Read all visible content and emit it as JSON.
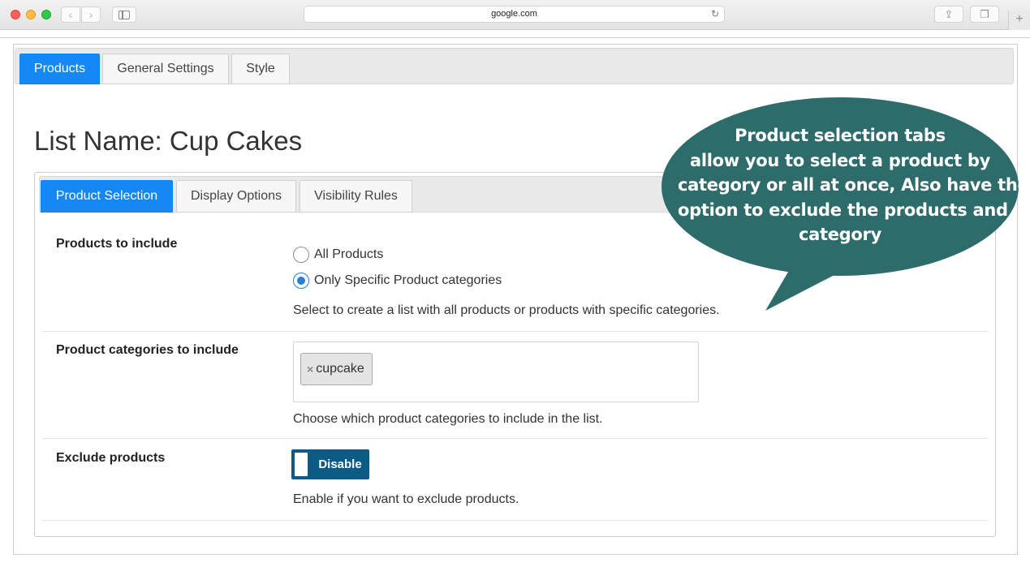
{
  "browser": {
    "url": "google.com"
  },
  "main_tabs": [
    {
      "label": "Products",
      "active": true
    },
    {
      "label": "General Settings",
      "active": false
    },
    {
      "label": "Style",
      "active": false
    }
  ],
  "page": {
    "title": "List Name: Cup Cakes"
  },
  "inner_tabs": [
    {
      "label": "Product Selection",
      "active": true
    },
    {
      "label": "Display Options",
      "active": false
    },
    {
      "label": "Visibility Rules",
      "active": false
    }
  ],
  "products_to_include": {
    "label": "Products to include",
    "options": [
      {
        "label": "All Products",
        "checked": false
      },
      {
        "label": "Only Specific Product categories",
        "checked": true
      }
    ],
    "help": "Select to create a list with all products or products with specific categories."
  },
  "categories_to_include": {
    "label": "Product categories to include",
    "selected": [
      "cupcake"
    ],
    "remove_glyph": "×",
    "help": "Choose which product categories to include in the list."
  },
  "exclude_products": {
    "label": "Exclude products",
    "toggle_label": "Disable",
    "enabled": false,
    "help": "Enable if you want to exclude products."
  },
  "callout": {
    "lines": [
      "Product selection tabs",
      "allow you to select a product by",
      "category or all at once, Also have the",
      "option to exclude the products and",
      "category"
    ],
    "color": "#2e6b6b"
  },
  "colors": {
    "accent": "#1688f5",
    "toggle": "#0d5a86",
    "radio": "#2a7fd4"
  }
}
